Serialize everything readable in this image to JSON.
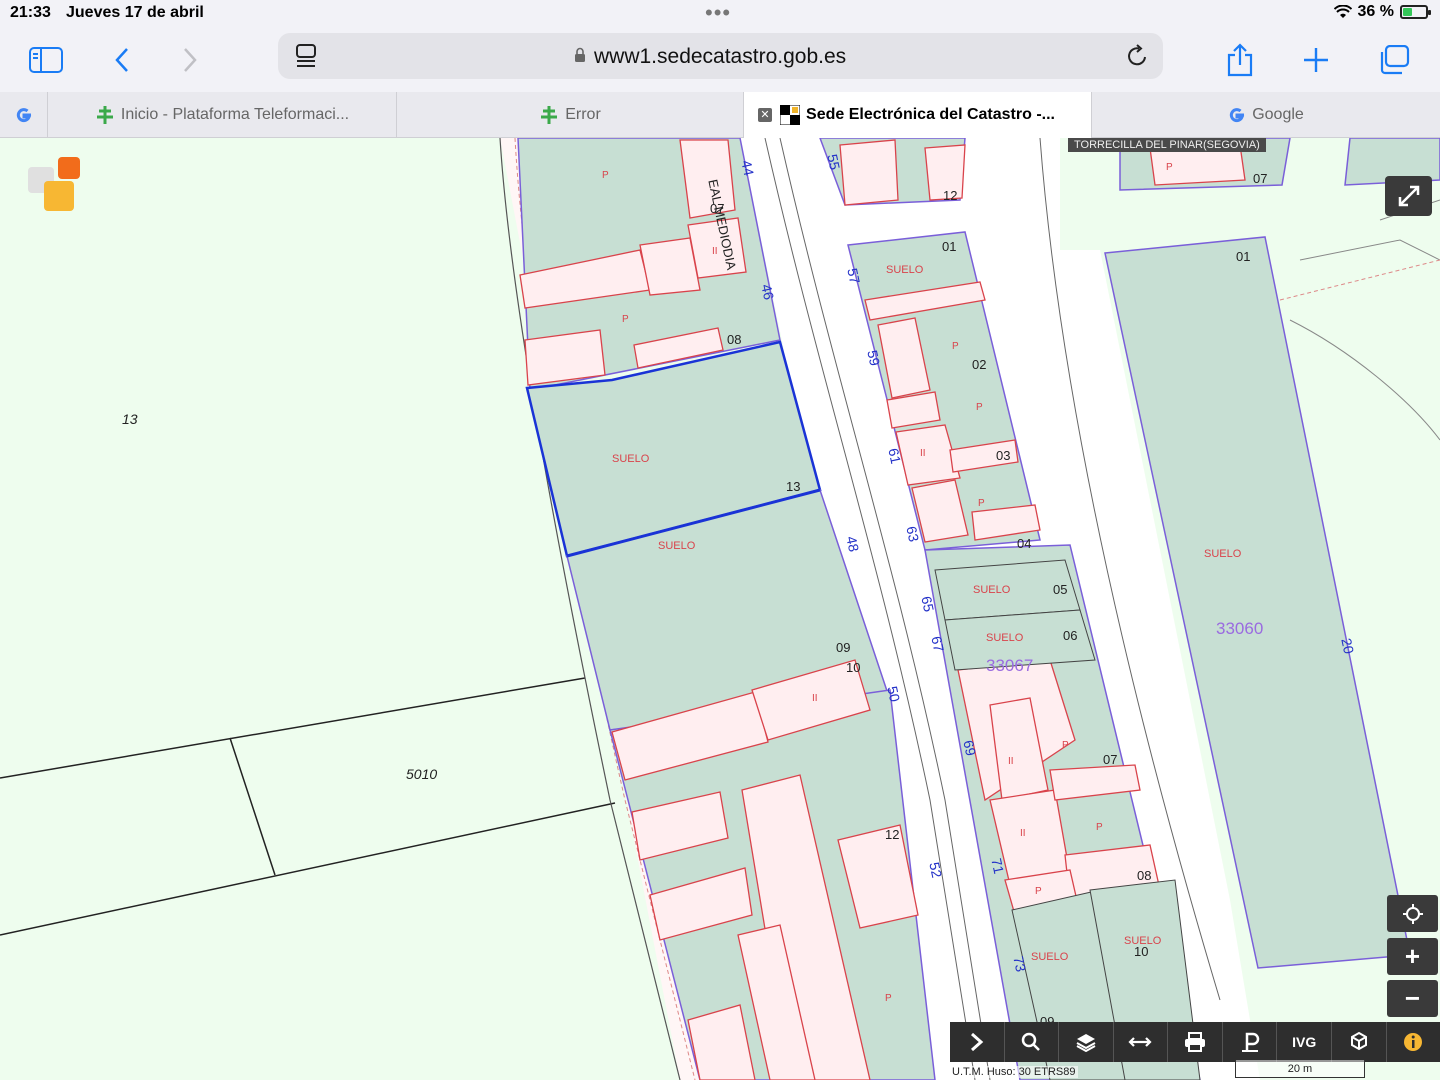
{
  "status_bar": {
    "time": "21:33",
    "date": "Jueves 17 de abril",
    "battery": "36 %",
    "battery_level": 0.36
  },
  "url_bar": {
    "url": "www1.sedecatastro.gob.es"
  },
  "tabs": [
    {
      "label": "",
      "favicon": "google-icon"
    },
    {
      "label": "Inicio - Plataforma Teleformaci...",
      "favicon": "platform-icon"
    },
    {
      "label": "Error",
      "favicon": "platform-icon"
    },
    {
      "label": "Sede Electrónica del Catastro -...",
      "favicon": "catastro-icon",
      "active": true
    },
    {
      "label": "Google",
      "favicon": "google-icon"
    }
  ],
  "map": {
    "municipality": "TORRECILLA DEL PINAR(SEGOVIA)",
    "street_label": "EAL MEDIODIA",
    "parcels": {
      "left_big": "13",
      "left_lower": "5010",
      "block_mid": "33067",
      "block_right": "33060"
    },
    "labels": {
      "suelo": "SUELO",
      "p": "P",
      "i": "I",
      "ii": "II",
      "n07": "07",
      "n08": "08",
      "n13": "13",
      "n09": "09",
      "n10": "10",
      "n12": "12",
      "n01": "01",
      "n02": "02",
      "n03": "03",
      "n04": "04",
      "n05": "05",
      "n06": "06",
      "n01b": "01",
      "n07b": "07",
      "n07c": "07",
      "n08b": "08",
      "n10b": "10",
      "n09b": "09",
      "n12b": "12"
    },
    "street_numbers": [
      "44",
      "46",
      "48",
      "50",
      "52",
      "55",
      "57",
      "59",
      "61",
      "63",
      "65",
      "67",
      "69",
      "71",
      "73",
      "20"
    ],
    "scale_label": "20 m",
    "utm_label": "U.T.M. Huso: 30 ETRS89"
  },
  "controls": {
    "locate": "locate-icon",
    "zoom_in": "+",
    "zoom_out": "−",
    "toolbar": [
      "next-icon",
      "search-icon",
      "layers-icon",
      "measure-icon",
      "print-icon",
      "parking-icon",
      "IVG",
      "parcels-icon",
      "info-icon"
    ],
    "ivg_label": "IVG"
  }
}
